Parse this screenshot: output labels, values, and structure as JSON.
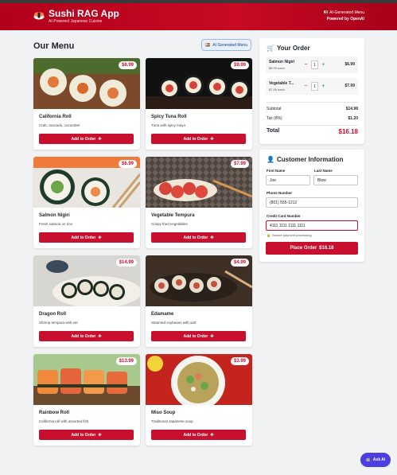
{
  "header": {
    "title": "Sushi RAG App",
    "subtitle": "AI-Powered Japanese Cuisine",
    "badge": "AI-Generated Menu",
    "powered_by": "Powered by OpenAI"
  },
  "menu": {
    "title": "Our Menu",
    "chip_label": "AI Generated Menu",
    "add_label": "Add to Order",
    "items": [
      {
        "name": "California Roll",
        "desc": "Crab, avocado, cucumber",
        "price": "$8.99"
      },
      {
        "name": "Spicy Tuna Roll",
        "desc": "Tuna with spicy mayo",
        "price": "$9.99"
      },
      {
        "name": "Salmon Nigiri",
        "desc": "Fresh salmon on rice",
        "price": "$6.99"
      },
      {
        "name": "Vegetable Tempura",
        "desc": "Crispy fried vegetables",
        "price": "$7.99"
      },
      {
        "name": "Dragon Roll",
        "desc": "Shrimp tempura with eel",
        "price": "$14.99"
      },
      {
        "name": "Edamame",
        "desc": "Steamed soybeans with salt",
        "price": "$4.99"
      },
      {
        "name": "Rainbow Roll",
        "desc": "California roll with assorted fish",
        "price": "$13.99"
      },
      {
        "name": "Miso Soup",
        "desc": "Traditional Japanese soup",
        "price": "$3.99"
      }
    ]
  },
  "order": {
    "title": "Your Order",
    "items": [
      {
        "name": "Salmon Nigiri",
        "each": "$6.99 each",
        "qty": "1",
        "price": "$6.99"
      },
      {
        "name": "Vegetable T...",
        "each": "$7.99 each",
        "qty": "1",
        "price": "$7.99"
      }
    ],
    "subtotal_label": "Subtotal",
    "subtotal": "$14.98",
    "tax_label": "Tax (8%)",
    "tax": "$1.20",
    "total_label": "Total",
    "total": "$16.18"
  },
  "customer": {
    "title": "Customer Information",
    "first_label": "First Name",
    "first_value": "Joe",
    "last_label": "Last Name",
    "last_value": "Blow",
    "phone_label": "Phone Number",
    "phone_value": "(801) 555-1212",
    "card_label": "Credit Card Number",
    "card_value": "4111 1111 1111 1111",
    "secure_note": "Secure payment processing",
    "place_label": "Place Order",
    "place_amount": "$16.18"
  },
  "assistant": {
    "label": "Ask AI"
  },
  "colors": {
    "brand": "#c8102e",
    "accent": "#4c3ee0"
  }
}
